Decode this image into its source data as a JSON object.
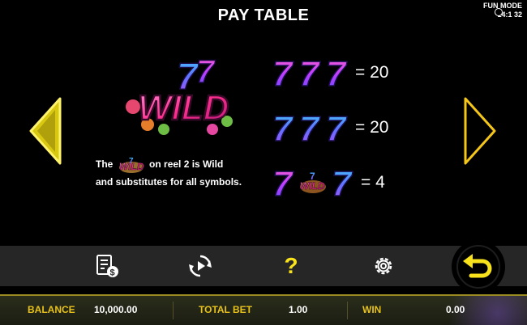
{
  "header": {
    "title": "PAY TABLE",
    "mode_label": "FUN MODE",
    "clock": "14:1  32"
  },
  "wild": {
    "logo_text": "WILD",
    "description_line1_pre": "The",
    "description_line1_post": "on reel 2 is Wild",
    "description_line2": "and substitutes for all symbols."
  },
  "paytable": [
    {
      "symbols": [
        "7",
        "7",
        "7"
      ],
      "symbol_style": "pink-purple",
      "payout": "= 20"
    },
    {
      "symbols": [
        "7",
        "7",
        "7"
      ],
      "symbol_style": "blue-purple",
      "payout": "= 20"
    },
    {
      "symbols": [
        "7",
        "WILD",
        "7"
      ],
      "symbol_style": "mixed-wild",
      "payout": "= 4"
    }
  ],
  "toolbar": {
    "icons": [
      "paytable-icon",
      "autoplay-icon",
      "help-icon",
      "settings-icon",
      "back-icon"
    ],
    "help_glyph": "?"
  },
  "status_bar": {
    "balance_label": "BALANCE",
    "balance_value": "10,000.00",
    "total_bet_label": "TOTAL BET",
    "total_bet_value": "1.00",
    "win_label": "WIN",
    "win_value": "0.00"
  },
  "colors": {
    "accent_yellow": "#f7e21c",
    "label_gold": "#e8c21a",
    "seven_pink": "#ff3fa4",
    "seven_blue": "#3aa7ff",
    "seven_purple": "#8a4dff"
  }
}
